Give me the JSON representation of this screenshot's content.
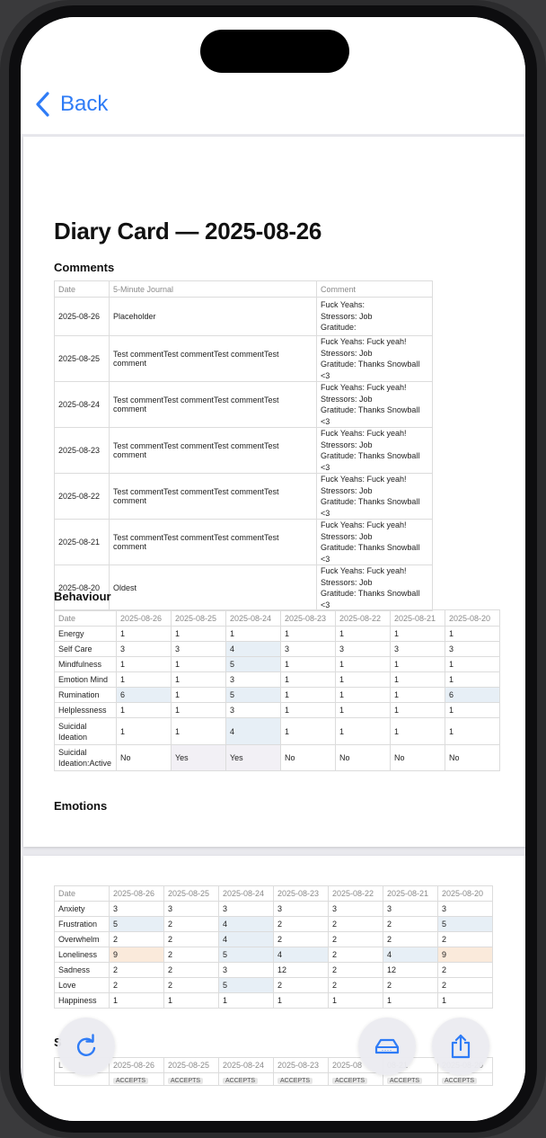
{
  "nav": {
    "back_label": "Back"
  },
  "doc": {
    "title": "Diary Card — 2025-08-26"
  },
  "comments": {
    "heading": "Comments",
    "headers": [
      "Date",
      "5-Minute Journal",
      "Comment"
    ],
    "rows": [
      {
        "date": "2025-08-26",
        "journal": "Placeholder",
        "comment": [
          "Fuck Yeahs:",
          "Stressors: Job",
          "Gratitude:"
        ]
      },
      {
        "date": "2025-08-25",
        "journal": "Test commentTest commentTest commentTest comment",
        "comment": [
          "Fuck Yeahs: Fuck yeah!",
          "Stressors: Job",
          "Gratitude: Thanks Snowball <3"
        ]
      },
      {
        "date": "2025-08-24",
        "journal": "Test commentTest commentTest commentTest comment",
        "comment": [
          "Fuck Yeahs: Fuck yeah!",
          "Stressors: Job",
          "Gratitude: Thanks Snowball <3"
        ]
      },
      {
        "date": "2025-08-23",
        "journal": "Test commentTest commentTest commentTest comment",
        "comment": [
          "Fuck Yeahs: Fuck yeah!",
          "Stressors: Job",
          "Gratitude: Thanks Snowball <3"
        ]
      },
      {
        "date": "2025-08-22",
        "journal": "Test commentTest commentTest commentTest comment",
        "comment": [
          "Fuck Yeahs: Fuck yeah!",
          "Stressors: Job",
          "Gratitude: Thanks Snowball <3"
        ]
      },
      {
        "date": "2025-08-21",
        "journal": "Test commentTest commentTest commentTest comment",
        "comment": [
          "Fuck Yeahs: Fuck yeah!",
          "Stressors: Job",
          "Gratitude: Thanks Snowball <3"
        ]
      },
      {
        "date": "2025-08-20",
        "journal": "Oldest",
        "comment": [
          "Fuck Yeahs: Fuck yeah!",
          "Stressors: Job",
          "Gratitude: Thanks Snowball <3"
        ]
      }
    ]
  },
  "behaviour": {
    "heading": "Behaviour",
    "headers": [
      "Date",
      "2025-08-26",
      "2025-08-25",
      "2025-08-24",
      "2025-08-23",
      "2025-08-22",
      "2025-08-21",
      "2025-08-20"
    ],
    "rows": [
      {
        "label": "Energy",
        "values": [
          "1",
          "1",
          "1",
          "1",
          "1",
          "1",
          "1"
        ],
        "hl": [
          0,
          0,
          0,
          0,
          0,
          0,
          0
        ]
      },
      {
        "label": "Self Care",
        "values": [
          "3",
          "3",
          "4",
          "3",
          "3",
          "3",
          "3"
        ],
        "hl": [
          0,
          0,
          1,
          0,
          0,
          0,
          0
        ]
      },
      {
        "label": "Mindfulness",
        "values": [
          "1",
          "1",
          "5",
          "1",
          "1",
          "1",
          "1"
        ],
        "hl": [
          0,
          0,
          1,
          0,
          0,
          0,
          0
        ]
      },
      {
        "label": "Emotion Mind",
        "values": [
          "1",
          "1",
          "3",
          "1",
          "1",
          "1",
          "1"
        ],
        "hl": [
          0,
          0,
          0,
          0,
          0,
          0,
          0
        ]
      },
      {
        "label": "Rumination",
        "values": [
          "6",
          "1",
          "5",
          "1",
          "1",
          "1",
          "6"
        ],
        "hl": [
          1,
          0,
          1,
          0,
          0,
          0,
          1
        ]
      },
      {
        "label": "Helplessness",
        "values": [
          "1",
          "1",
          "3",
          "1",
          "1",
          "1",
          "1"
        ],
        "hl": [
          0,
          0,
          0,
          0,
          0,
          0,
          0
        ]
      },
      {
        "label": "Suicidal Ideation",
        "values": [
          "1",
          "1",
          "4",
          "1",
          "1",
          "1",
          "1"
        ],
        "hl": [
          0,
          0,
          1,
          0,
          0,
          0,
          0
        ]
      },
      {
        "label": "Suicidal Ideation:Active",
        "values": [
          "No",
          "Yes",
          "Yes",
          "No",
          "No",
          "No",
          "No"
        ],
        "hl": [
          0,
          3,
          3,
          0,
          0,
          0,
          0
        ]
      }
    ]
  },
  "emotions": {
    "heading": "Emotions",
    "headers": [
      "Date",
      "2025-08-26",
      "2025-08-25",
      "2025-08-24",
      "2025-08-23",
      "2025-08-22",
      "2025-08-21",
      "2025-08-20"
    ],
    "rows": [
      {
        "label": "Anxiety",
        "values": [
          "3",
          "3",
          "3",
          "3",
          "3",
          "3",
          "3"
        ],
        "hl": [
          0,
          0,
          0,
          0,
          0,
          0,
          0
        ]
      },
      {
        "label": "Frustration",
        "values": [
          "5",
          "2",
          "4",
          "2",
          "2",
          "2",
          "5"
        ],
        "hl": [
          1,
          0,
          1,
          0,
          0,
          0,
          1
        ]
      },
      {
        "label": "Overwhelm",
        "values": [
          "2",
          "2",
          "4",
          "2",
          "2",
          "2",
          "2"
        ],
        "hl": [
          0,
          0,
          1,
          0,
          0,
          0,
          0
        ]
      },
      {
        "label": "Loneliness",
        "values": [
          "9",
          "2",
          "5",
          "4",
          "2",
          "4",
          "9"
        ],
        "hl": [
          2,
          0,
          1,
          1,
          0,
          1,
          2
        ]
      },
      {
        "label": "Sadness",
        "values": [
          "2",
          "2",
          "3",
          "12",
          "2",
          "12",
          "2"
        ],
        "hl": [
          0,
          0,
          0,
          0,
          0,
          0,
          0
        ]
      },
      {
        "label": "Love",
        "values": [
          "2",
          "2",
          "5",
          "2",
          "2",
          "2",
          "2"
        ],
        "hl": [
          0,
          0,
          1,
          0,
          0,
          0,
          0
        ]
      },
      {
        "label": "Happiness",
        "values": [
          "1",
          "1",
          "1",
          "1",
          "1",
          "1",
          "1"
        ],
        "hl": [
          0,
          0,
          0,
          0,
          0,
          0,
          0
        ]
      }
    ]
  },
  "skills": {
    "heading_partial": "S",
    "header_partial": "L",
    "headers": [
      "2025-08-26",
      "2025-08-25",
      "2025-08-24",
      "2025-08-23",
      "2025-08",
      "08-21",
      "2025-08-20"
    ],
    "tag": "ACCEPTS"
  },
  "colors": {
    "accent": "#2f7cf6",
    "highlight_blue": "#e7eff6",
    "highlight_orange": "#faeadb",
    "highlight_purple": "#f2f0f5"
  },
  "icons": {
    "refresh": "refresh-icon",
    "printer": "printer-icon",
    "share": "share-icon",
    "back": "chevron-left-icon"
  }
}
